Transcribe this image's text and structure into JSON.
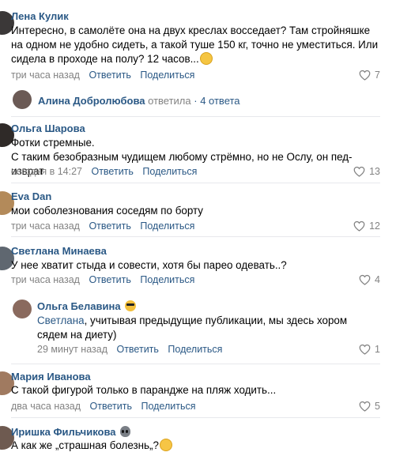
{
  "comments": [
    {
      "name": "Лена Кулик",
      "text": "Интересно, в самолёте она на двух креслах восседает? Там стройняшке на одном не удобно сидеть, а такой туше 150 кг, точно не уместиться. Или сидела в проходе на полу? 12 часов...",
      "time": "три часа назад",
      "reply": "Ответить",
      "share": "Поделиться",
      "likes": "7"
    },
    {
      "thread_name": "Алина Добролюбова",
      "thread_verb": "ответила",
      "thread_count": "· 4 ответа"
    },
    {
      "name": "Ольга Шарова",
      "text1": "Фотки стремные.",
      "text2": "С таким безобразным чудищем любому стрёмно, но не Ослу, он пед-изврат",
      "time": "сегодня в 14:27",
      "reply": "Ответить",
      "share": "Поделиться",
      "likes": "13"
    },
    {
      "name": "Eva Dan",
      "text": "мои соболезнования соседям по борту",
      "time": "три часа назад",
      "reply": "Ответить",
      "share": "Поделиться",
      "likes": "12"
    },
    {
      "name": "Светлана Минаева",
      "text": "У нее хватит стыда и совести, хотя бы парео одевать..?",
      "time": "три часа назад",
      "reply": "Ответить",
      "share": "Поделиться",
      "likes": "4"
    },
    {
      "name": "Ольга Белавина",
      "mention": "Светлана",
      "text": ", учитывая предыдущие публикации, мы здесь хором сядем на диету)",
      "time": "29 минут назад",
      "reply": "Ответить",
      "share": "Поделиться",
      "likes": "1"
    },
    {
      "name": "Мария Иванова",
      "text": "С такой фигурой только в парандже на пляж ходить...",
      "time": "два часа назад",
      "reply": "Ответить",
      "share": "Поделиться",
      "likes": "5"
    },
    {
      "name": "Иришка Фильчикова",
      "text": "А как же „страшная болезнь„?"
    }
  ],
  "icons": {
    "like": "heart-outline-icon",
    "emoji_think": "thinking-face-icon",
    "emoji_cool": "sunglasses-face-icon",
    "emoji_alien": "alien-icon",
    "emoji_scream": "screaming-face-icon"
  },
  "colors": {
    "link": "#2a5885",
    "meta": "#828282",
    "divider": "#e7e8ec"
  }
}
